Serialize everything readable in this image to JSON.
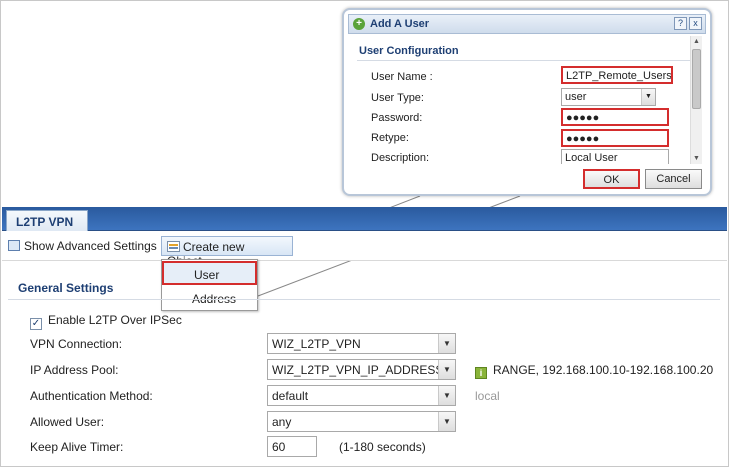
{
  "colors": {
    "accent_red": "#d42d2d",
    "header_blue": "#2a5a9e",
    "title_blue": "#1e3f73"
  },
  "dialog": {
    "title": "Add A User",
    "help_label": "?",
    "close_label": "x",
    "section": "User Configuration",
    "fields": [
      {
        "label": "User Name :",
        "value": "L2TP_Remote_Users"
      },
      {
        "label": "User Type:",
        "value": "user"
      },
      {
        "label": "Password:",
        "value": "●●●●●"
      },
      {
        "label": "Retype:",
        "value": "●●●●●"
      },
      {
        "label": "Description:",
        "value": "Local User"
      }
    ],
    "ok_label": "OK",
    "cancel_label": "Cancel"
  },
  "tab": {
    "label": "L2TP VPN"
  },
  "toolbar": {
    "advanced_label": "Show Advanced Settings",
    "create_label": "Create new Object"
  },
  "dropdown": {
    "items": [
      "User",
      "Address"
    ]
  },
  "general": {
    "title": "General Settings",
    "enable_label": "Enable L2TP Over IPSec",
    "vpn_connection": {
      "label": "VPN Connection:",
      "value": "WIZ_L2TP_VPN"
    },
    "ip_pool": {
      "label": "IP Address Pool:",
      "value": "WIZ_L2TP_VPN_IP_ADDRESS_",
      "info": "RANGE, 192.168.100.10-192.168.100.20"
    },
    "auth": {
      "label": "Authentication Method:",
      "value": "default",
      "hint": "local"
    },
    "allowed": {
      "label": "Allowed User:",
      "value": "any"
    },
    "keepalive": {
      "label": "Keep Alive Timer:",
      "value": "60",
      "hint": "(1-180 seconds)"
    }
  }
}
